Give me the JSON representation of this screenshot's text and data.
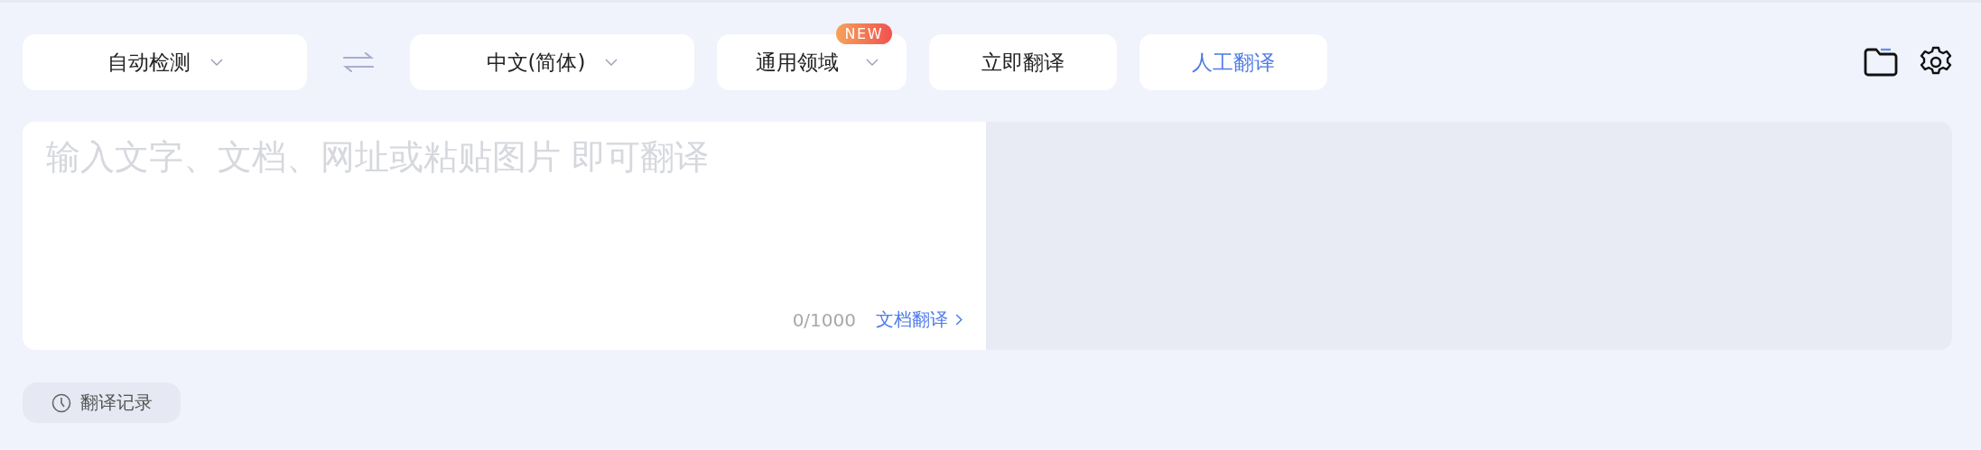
{
  "toolbar": {
    "source_language": {
      "label": "自动检测"
    },
    "target_language": {
      "label": "中文(简体)"
    },
    "controls": [
      {
        "kind": "dropdown",
        "label": "通用领域",
        "badge": "NEW"
      },
      {
        "kind": "button",
        "label": "立即翻译"
      },
      {
        "kind": "accent-button",
        "label": "人工翻译"
      }
    ]
  },
  "editor": {
    "placeholder": "输入文字、文档、网址或粘贴图片 即可翻译",
    "char_count": "0/1000",
    "document_link": "文档翻译"
  },
  "history_button": {
    "label": "翻译记录"
  }
}
